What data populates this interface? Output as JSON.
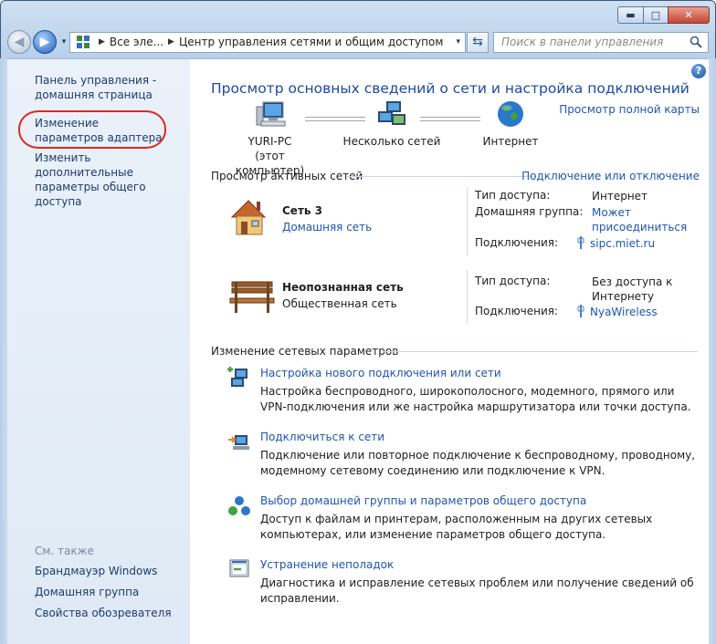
{
  "window": {
    "min_glyph": "▬",
    "max_glyph": "□",
    "close_glyph": "✕"
  },
  "nav": {
    "back_glyph": "◀",
    "forward_glyph": "▶",
    "dropdown_glyph": "▾",
    "breadcrumb_1": "Все эле...",
    "breadcrumb_2": "Центр управления сетями и общим доступом",
    "crumb_sep": "▶",
    "refresh_glyph": "⇆"
  },
  "search": {
    "placeholder": "Поиск в панели управления"
  },
  "sidebar": {
    "home": "Панель управления - домашняя страница",
    "adapter": "Изменение параметров адаптера",
    "sharing": "Изменить дополнительные параметры общего доступа",
    "see_also": "См. также",
    "firewall": "Брандмауэр Windows",
    "homegroup": "Домашняя группа",
    "browser": "Свойства обозревателя"
  },
  "main": {
    "help": "?",
    "title": "Просмотр основных сведений о сети и настройка подключений",
    "full_map": "Просмотр полной карты",
    "map": {
      "pc_name": "YURI-PC",
      "pc_sub": "(этот компьютер)",
      "multi": "Несколько сетей",
      "internet": "Интернет"
    },
    "active_header": "Просмотр активных сетей",
    "connect_link": "Подключение или отключение",
    "net1": {
      "name": "Сеть  3",
      "type": "Домашняя сеть",
      "access_k": "Тип доступа:",
      "access_v": "Интернет",
      "hg_k": "Домашняя группа:",
      "hg_v1": "Может",
      "hg_v2": "присоединиться",
      "conn_k": "Подключения:",
      "conn_v": "sipc.miet.ru"
    },
    "net2": {
      "name": "Неопознанная сеть",
      "type": "Общественная сеть",
      "access_k": "Тип доступа:",
      "access_v1": "Без доступа к",
      "access_v2": "Интернету",
      "conn_k": "Подключения:",
      "conn_v": "NyaWireless"
    },
    "change_header": "Изменение сетевых параметров",
    "tasks": [
      {
        "link": "Настройка нового подключения или сети",
        "desc": "Настройка беспроводного, широкополосного, модемного, прямого или VPN-подключения или же настройка маршрутизатора или точки доступа."
      },
      {
        "link": "Подключиться к сети",
        "desc": "Подключение или повторное подключение к беспроводному, проводному, модемному сетевому соединению или подключение к VPN."
      },
      {
        "link": "Выбор домашней группы и параметров общего доступа",
        "desc": "Доступ к файлам и принтерам, расположенным на других сетевых компьютерах, или изменение параметров общего доступа."
      },
      {
        "link": "Устранение неполадок",
        "desc": "Диагностика и исправление сетевых проблем или получение сведений об исправлении."
      }
    ]
  }
}
